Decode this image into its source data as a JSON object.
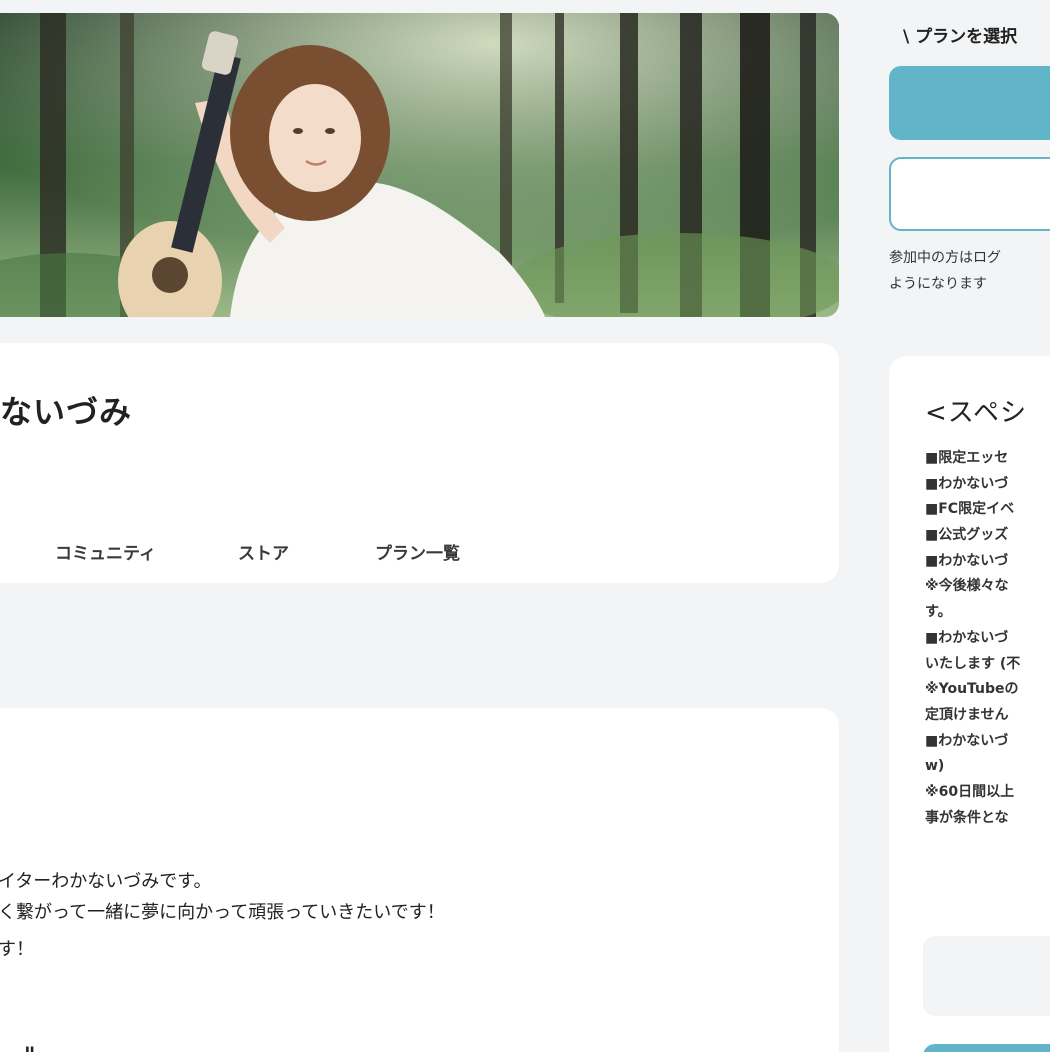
{
  "profile": {
    "name": "ないづみ"
  },
  "tabs": [
    {
      "label": "コミュニティ"
    },
    {
      "label": "ストア"
    },
    {
      "label": "プラン一覧"
    }
  ],
  "about": {
    "lines": [
      "ライターわかないづみです。",
      "深く繋がって一緒に夢に向かって頑張っていきたいです！",
      "ます！"
    ],
    "heading": "ィー\""
  },
  "sidebar": {
    "select_plan_label": "\\ プランを選択",
    "login_note": [
      "参加中の方はログ",
      "ようになります"
    ],
    "special": {
      "title": "<スペシ",
      "lines": [
        "■限定エッセ",
        "■わかないづ",
        "■FC限定イベ",
        "■公式グッズ",
        "■わかないづ",
        "※今後様々な",
        "す。",
        "■わかないづ",
        "いたします (不",
        "※YouTubeの",
        "定頂けません",
        "■わかないづ",
        "w)",
        "※60日間以上",
        "事が条件とな"
      ]
    }
  },
  "colors": {
    "accent": "#62b4c8",
    "background": "#f3f4f6",
    "card": "#ffffff"
  }
}
